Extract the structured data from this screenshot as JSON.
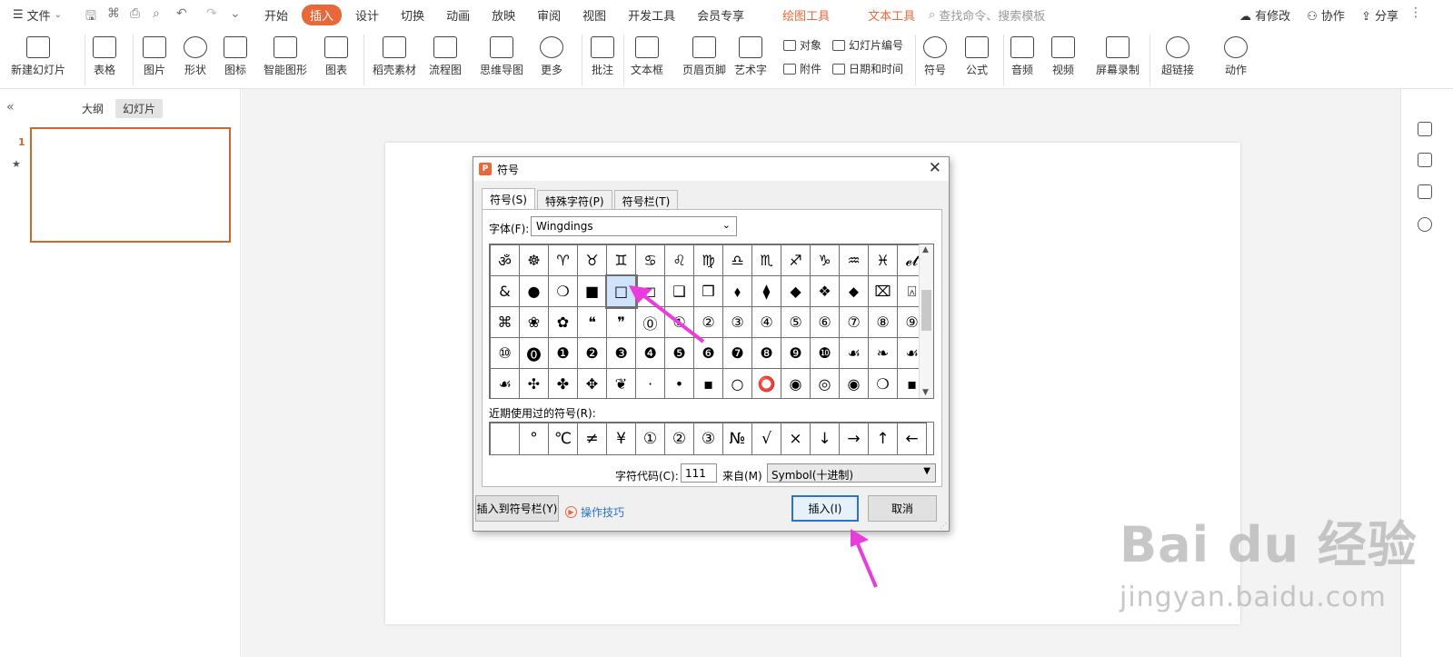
{
  "colors": {
    "accent": "#e8683a",
    "arrow": "#e93cdc",
    "primary_button_border": "#2a73c8"
  },
  "titlebar": {
    "file_menu": "文件",
    "tabs": [
      {
        "label": "开始"
      },
      {
        "label": "插入",
        "active": true
      },
      {
        "label": "设计"
      },
      {
        "label": "切换"
      },
      {
        "label": "动画"
      },
      {
        "label": "放映"
      },
      {
        "label": "审阅"
      },
      {
        "label": "视图"
      },
      {
        "label": "开发工具"
      },
      {
        "label": "会员专享"
      },
      {
        "label": "绘图工具",
        "contextual": true
      },
      {
        "label": "文本工具",
        "contextual": true
      }
    ],
    "search_placeholder": "查找命令、搜索模板",
    "actions": {
      "modified": "有修改",
      "collaborate": "协作",
      "share": "分享"
    }
  },
  "ribbon": {
    "buttons": {
      "new_slide": "新建幻灯片",
      "table": "表格",
      "picture": "图片",
      "shape": "形状",
      "icon": "图标",
      "smartart": "智能图形",
      "chart": "图表",
      "material": "稻壳素材",
      "flowchart": "流程图",
      "mindmap": "思维导图",
      "more": "更多",
      "comment": "批注",
      "textbox": "文本框",
      "header_footer": "页眉页脚",
      "wordart": "艺术字",
      "symbol": "符号",
      "formula": "公式",
      "audio": "音频",
      "video": "视频",
      "screen_record": "屏幕录制",
      "hyperlink": "超链接",
      "action": "动作"
    },
    "small": {
      "object": "对象",
      "slide_number": "幻灯片编号",
      "attachment": "附件",
      "datetime": "日期和时间"
    }
  },
  "left_panel": {
    "view_tabs": [
      "大纲",
      "幻灯片"
    ],
    "selected_view": "幻灯片",
    "slide_number": "1"
  },
  "dialog": {
    "title": "符号",
    "tabs": [
      "符号(S)",
      "特殊字符(P)",
      "符号栏(T)"
    ],
    "font_label": "字体(F):",
    "font_value": "Wingdings",
    "symbol_grid": [
      [
        "ॐ",
        "☸",
        "♈",
        "♉",
        "♊",
        "♋",
        "♌",
        "♍",
        "♎",
        "♏",
        "♐",
        "♑",
        "♒",
        "♓",
        "𝓮𝓽"
      ],
      [
        "&",
        "●",
        "❍",
        "■",
        "□",
        "◻",
        "❑",
        "❒",
        "⬧",
        "⧫",
        "◆",
        "❖",
        "⬥",
        "⌧",
        "⍓"
      ],
      [
        "⌘",
        "❀",
        "✿",
        "❝",
        "❞",
        "⓪",
        "①",
        "②",
        "③",
        "④",
        "⑤",
        "⑥",
        "⑦",
        "⑧",
        "⑨"
      ],
      [
        "⑩",
        "⓿",
        "❶",
        "❷",
        "❸",
        "❹",
        "❺",
        "❻",
        "❼",
        "❽",
        "❾",
        "❿",
        "☙",
        "❧",
        "☙"
      ],
      [
        "☙",
        "✣",
        "✤",
        "✥",
        "❦",
        "·",
        "•",
        "▪",
        "○",
        "⭕",
        "◉",
        "◎",
        "◉",
        "❍",
        "▪"
      ]
    ],
    "selected_symbol": "□",
    "recent_label": "近期使用过的符号(R):",
    "recent_symbols": [
      "",
      "°",
      "℃",
      "≠",
      "¥",
      "①",
      "②",
      "③",
      "№",
      "√",
      "×",
      "↓",
      "→",
      "↑",
      "←"
    ],
    "char_code_label": "字符代码(C):",
    "char_code_value": "111",
    "from_label": "来自(M)",
    "from_value": "Symbol(十进制)",
    "insert_to_bar_label": "插入到符号栏(Y)",
    "tips_label": "操作技巧",
    "insert_label": "插入(I)",
    "cancel_label": "取消"
  },
  "watermark": {
    "brand": "Bai du 经验",
    "url": "jingyan.baidu.com"
  }
}
